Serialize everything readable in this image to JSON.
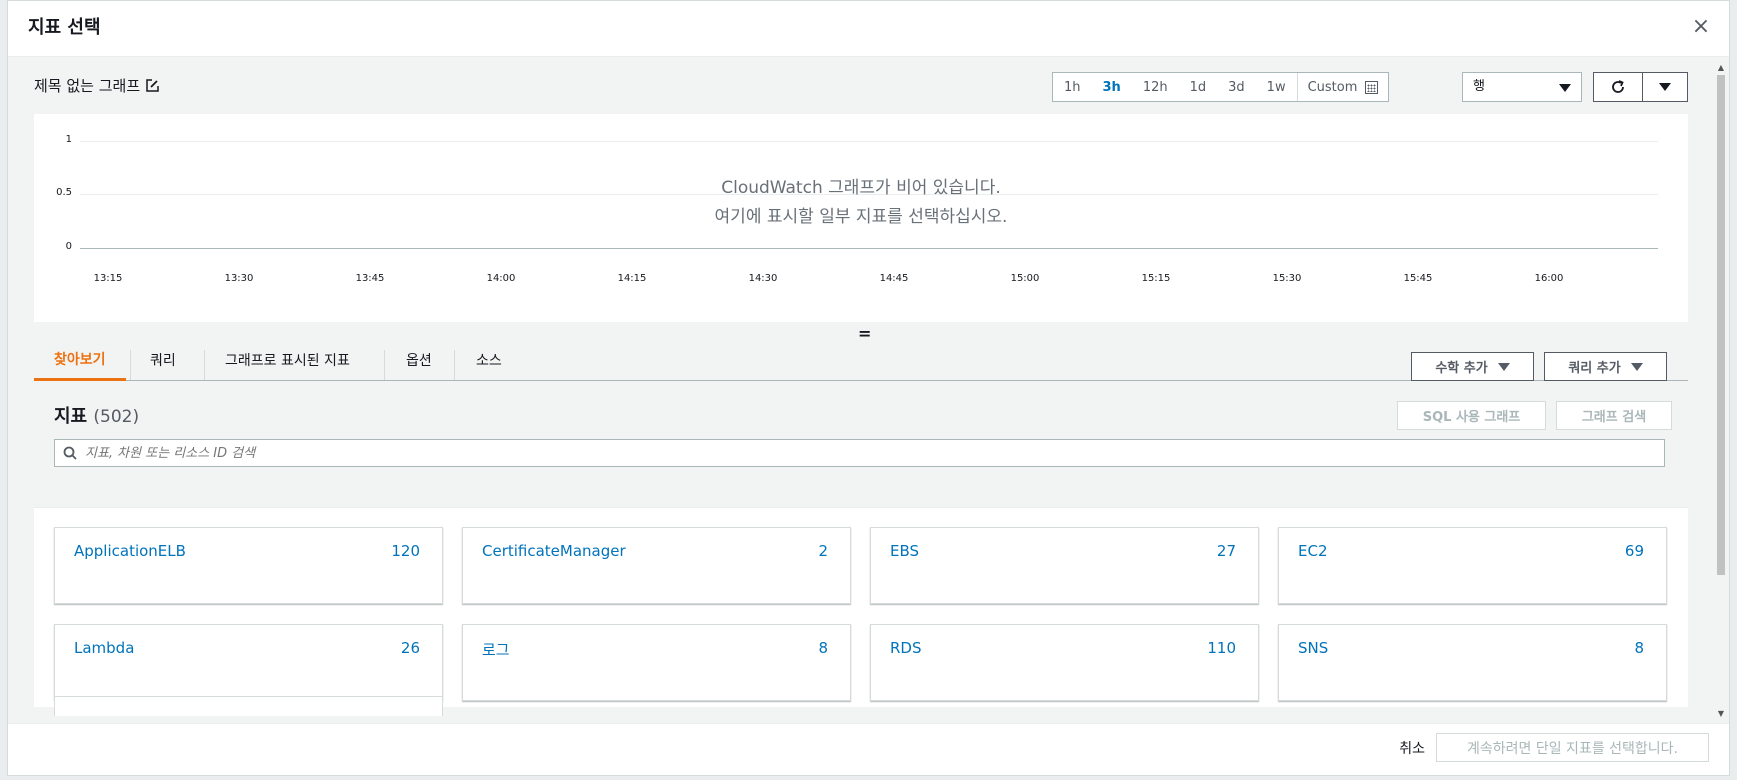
{
  "modal": {
    "title": "지표 선택",
    "close_icon": "×"
  },
  "graph": {
    "title": "제목 없는 그래프",
    "time_ranges": [
      "1h",
      "3h",
      "12h",
      "1d",
      "3d",
      "1w"
    ],
    "active_time_range": "3h",
    "custom_label": "Custom",
    "view_select": "행",
    "y_ticks": [
      "1",
      "0.5",
      "0"
    ],
    "x_ticks": [
      "13:15",
      "13:30",
      "13:45",
      "14:00",
      "14:15",
      "14:30",
      "14:45",
      "15:00",
      "15:15",
      "15:30",
      "15:45",
      "16:00"
    ],
    "empty_line1": "CloudWatch 그래프가 비어 있습니다.",
    "empty_line2": "여기에 표시할 일부 지표를 선택하십시오."
  },
  "resize_handle": "=",
  "tabs": [
    {
      "label": "찾아보기",
      "active": true
    },
    {
      "label": "쿼리",
      "active": false
    },
    {
      "label": "그래프로 표시된 지표",
      "active": false
    },
    {
      "label": "옵션",
      "active": false
    },
    {
      "label": "소스",
      "active": false
    }
  ],
  "actions": {
    "math_label": "수학 추가",
    "query_label": "쿼리 추가"
  },
  "metrics": {
    "title": "지표",
    "count": "(502)",
    "sql_button": "SQL 사용 그래프",
    "search_button": "그래프 검색",
    "search_placeholder": "지표, 차원 또는 리소스 ID 검색",
    "namespaces": [
      {
        "name": "ApplicationELB",
        "count": "120"
      },
      {
        "name": "CertificateManager",
        "count": "2"
      },
      {
        "name": "EBS",
        "count": "27"
      },
      {
        "name": "EC2",
        "count": "69"
      },
      {
        "name": "Lambda",
        "count": "26"
      },
      {
        "name": "로그",
        "count": "8"
      },
      {
        "name": "RDS",
        "count": "110"
      },
      {
        "name": "SNS",
        "count": "8"
      }
    ]
  },
  "footer": {
    "cancel_label": "취소",
    "continue_label": "계속하려면 단일 지표를 선택합니다."
  },
  "colors": {
    "accent": "#ec7211",
    "link": "#0073bb",
    "disabled": "#aab7b8"
  }
}
